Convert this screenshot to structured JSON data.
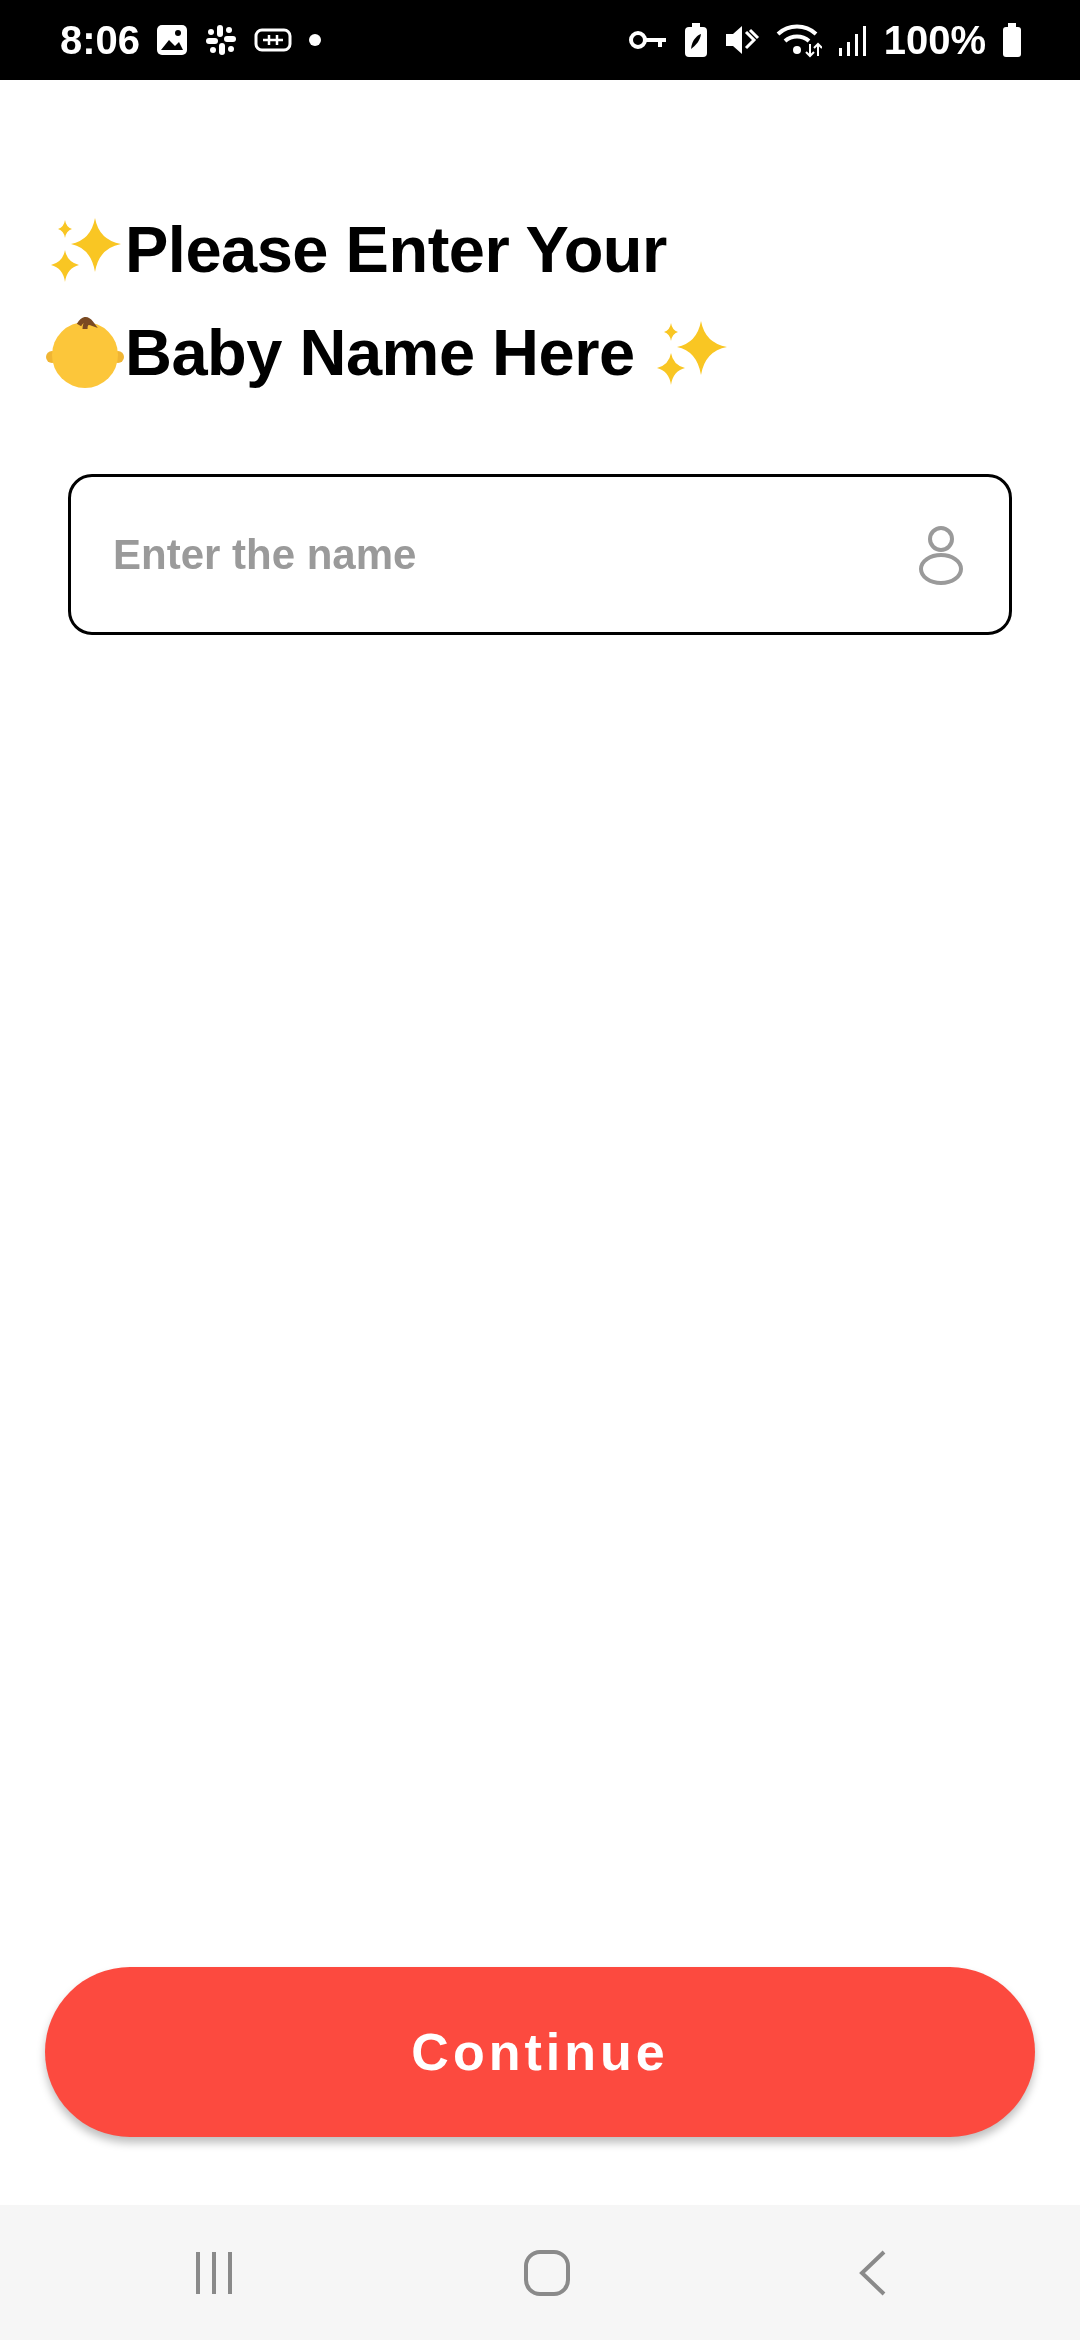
{
  "status_bar": {
    "time": "8:06",
    "battery": "100%"
  },
  "title_lines": [
    "Please Enter Your",
    "Baby Name Here"
  ],
  "name_field": {
    "placeholder": "Enter the name"
  },
  "continue_button": {
    "label": "Continue"
  }
}
